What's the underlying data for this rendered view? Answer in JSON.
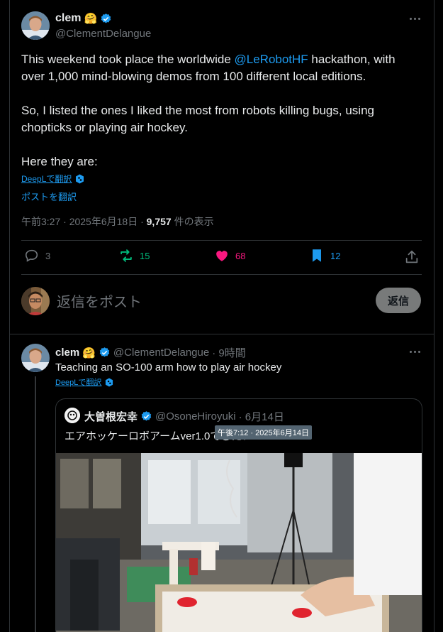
{
  "main_tweet": {
    "name": "clem",
    "emoji": "🤗",
    "handle": "@ClementDelangue",
    "text_pre": "This weekend took place the worldwide ",
    "mention": "@LeRobotHF",
    "text_post": " hackathon, with over 1,000 mind-blowing demos from 100 different local editions.",
    "para2": "So, I listed the ones I liked the most from robots killing bugs, using chopticks or playing air hockey.",
    "para3": "Here they are:",
    "deepl": "DeepLで翻訳",
    "translate": "ポストを翻訳",
    "timestamp": "午前3:27 · 2025年6月18日 · ",
    "views": "9,757",
    "views_suffix": " 件の表示",
    "replies": "3",
    "reposts": "15",
    "likes": "68",
    "bookmarks": "12"
  },
  "reply_box": {
    "placeholder": "返信をポスト",
    "button": "返信"
  },
  "thread_tweet": {
    "name": "clem",
    "emoji": "🤗",
    "handle": "@ClementDelangue",
    "time": "· 9時間",
    "text": "Teaching an SO-100 arm how to play air hockey",
    "deepl": "DeepLで翻訳"
  },
  "quoted_tweet": {
    "name": "大曽根宏幸",
    "handle": "@OsoneHiroyuki",
    "date": "· 6月14日",
    "text": "エアホッケーロボアームver1.0できた！",
    "tooltip": "午後7:12 · 2025年6月14日"
  },
  "colors": {
    "accent": "#1d9bf0",
    "like": "#f91880",
    "repost": "#00ba7c"
  }
}
